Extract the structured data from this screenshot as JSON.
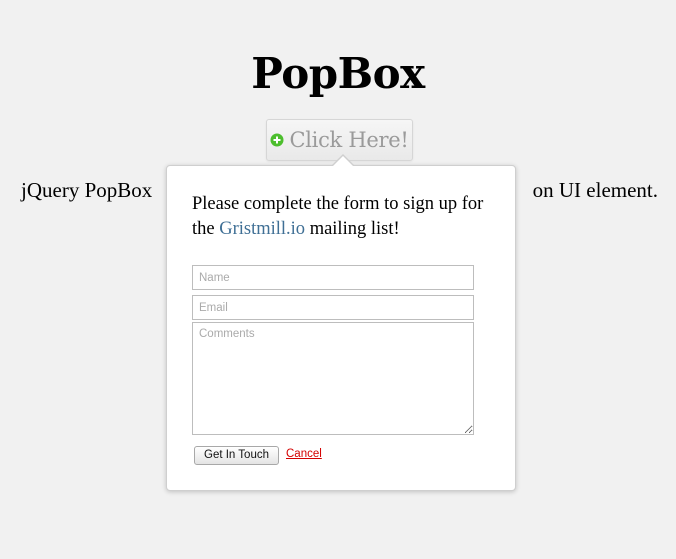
{
  "page": {
    "title": "PopBox",
    "description_left": "jQuery PopBox",
    "description_right": "on UI element."
  },
  "trigger": {
    "label": "Click Here!",
    "icon": "plus-circle-icon",
    "icon_color": "#4cbe2d"
  },
  "popbox": {
    "intro_before": "Please complete the form to sign up for the ",
    "link_text": "Gristmill.io",
    "intro_after": " mailing list!",
    "link_color": "#3f6f95",
    "form": {
      "name_placeholder": "Name",
      "email_placeholder": "Email",
      "comments_placeholder": "Comments",
      "submit_label": "Get In Touch",
      "cancel_label": "Cancel",
      "cancel_color": "#d40000"
    }
  }
}
